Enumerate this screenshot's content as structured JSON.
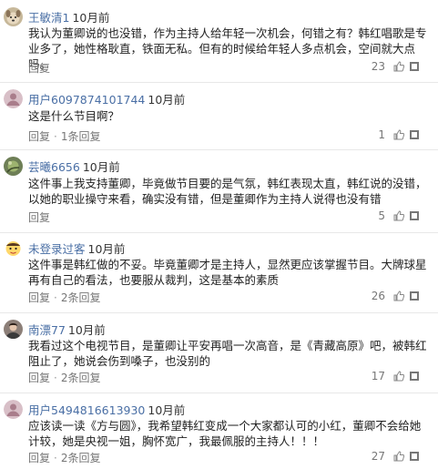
{
  "comments": [
    {
      "username": "王敏清1",
      "time": "10月前",
      "text": "我认为董卿说的也没错，作为主持人给年轻一次机会，何错之有？韩红唱歌是专业多了，她性格耿直，铁面无私。但有的时候给年轻人多点机会，空间就大点吗。",
      "reply": "回复",
      "reply_count": "",
      "likes": "23",
      "avatar_icon": "dog-avatar-icon"
    },
    {
      "username": "用户6097874101744",
      "time": "10月前",
      "text": "这是什么节目啊？",
      "reply": "回复",
      "reply_count": "1条回复",
      "likes": "1",
      "avatar_icon": "default-user-avatar-icon"
    },
    {
      "username": "芸曦6656",
      "time": "10月前",
      "text": "这件事上我支持董卿，毕竟做节目要的是气氛，韩红表现太直，韩红说的没错，以她的职业操守来看，确实没有错，但是董卿作为主持人说得也没有错",
      "reply": "回复",
      "reply_count": "",
      "likes": "5",
      "avatar_icon": "plant-avatar-icon"
    },
    {
      "username": "未登录过客",
      "time": "10月前",
      "text": "这件事是韩红做的不妥。毕竟董卿才是主持人，显然更应该掌握节目。大牌球星再有自己的看法，也要服从裁判，这是基本的素质",
      "reply": "回复",
      "reply_count": "2条回复",
      "likes": "26",
      "avatar_icon": "cartoon-face-avatar-icon"
    },
    {
      "username": "南漂77",
      "time": "10月前",
      "text": "我看过这个电视节目，是董卿让平安再唱一次高音，是《青藏高原》吧，被韩红阻止了，她说会伤到嗓子，也没别的",
      "reply": "回复",
      "reply_count": "2条回复",
      "likes": "17",
      "avatar_icon": "photo-avatar-icon"
    },
    {
      "username": "用户5494816613930",
      "time": "10月前",
      "text": "应该读一读《方与圆》，我希望韩红变成一个大家都认可的小红，董卿不会给她计较，她是央视一姐，胸怀宽广，我最佩服的主持人！！！",
      "reply": "回复",
      "reply_count": "2条回复",
      "likes": "27",
      "avatar_icon": "default-user-avatar-icon"
    }
  ],
  "reply_sep": "·",
  "icons": {
    "like": "thumbs-up-icon",
    "share": "share-icon"
  },
  "colors": {
    "username": "#4a6fa5",
    "default_avatar": "#d8bfc7"
  }
}
